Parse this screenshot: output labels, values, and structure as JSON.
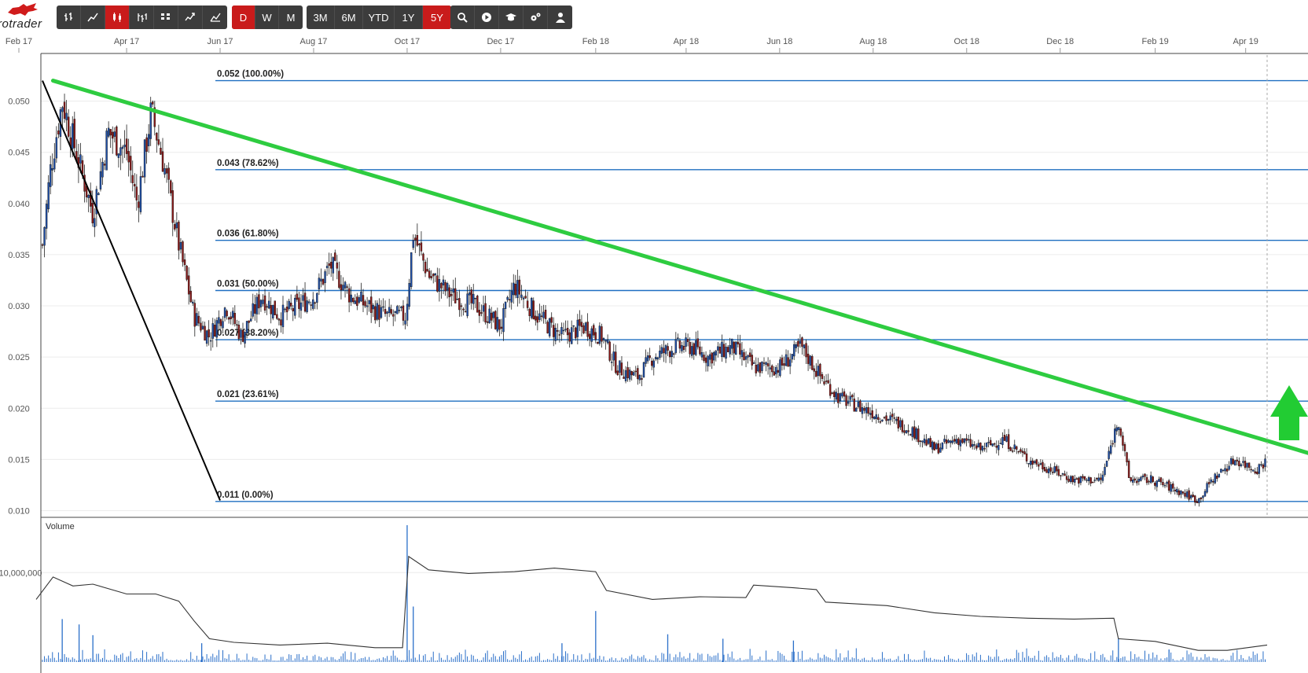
{
  "app": {
    "logo_text": "rotrader"
  },
  "toolbar": {
    "chart_types": [
      {
        "icon": "ohlc-bars-icon",
        "active": false
      },
      {
        "icon": "line-chart-icon",
        "active": false
      },
      {
        "icon": "candlestick-icon",
        "active": true
      },
      {
        "icon": "hlc-bars-icon",
        "active": false
      },
      {
        "icon": "renko-icon",
        "active": false
      },
      {
        "icon": "point-figure-icon",
        "active": false
      },
      {
        "icon": "mountain-chart-icon",
        "active": false
      }
    ],
    "intervals": [
      {
        "label": "D",
        "active": true
      },
      {
        "label": "W",
        "active": false
      },
      {
        "label": "M",
        "active": false
      }
    ],
    "ranges": [
      {
        "label": "3M",
        "active": false
      },
      {
        "label": "6M",
        "active": false
      },
      {
        "label": "YTD",
        "active": false
      },
      {
        "label": "1Y",
        "active": false
      },
      {
        "label": "5Y",
        "active": true
      }
    ],
    "tools": [
      {
        "icon": "search-icon"
      },
      {
        "icon": "play-icon"
      },
      {
        "icon": "graduation-cap-icon"
      },
      {
        "icon": "settings-gears-icon"
      },
      {
        "icon": "user-icon"
      }
    ]
  },
  "chart_data": {
    "type": "candlestick",
    "x_ticks": [
      "Feb 17",
      "Apr 17",
      "Jun 17",
      "Aug 17",
      "Oct 17",
      "Dec 17",
      "Feb 18",
      "Apr 18",
      "Jun 18",
      "Aug 18",
      "Oct 18",
      "Dec 18",
      "Feb 19",
      "Apr 19"
    ],
    "y_ticks": [
      "0.010",
      "0.015",
      "0.020",
      "0.025",
      "0.030",
      "0.035",
      "0.040",
      "0.045",
      "0.050"
    ],
    "ylim": [
      0.0095,
      0.0545
    ],
    "close_path": [
      [
        "2017-02-01",
        0.03
      ],
      [
        "2017-02-10",
        0.043
      ],
      [
        "2017-02-18",
        0.05
      ],
      [
        "2017-03-01",
        0.044
      ],
      [
        "2017-03-10",
        0.039
      ],
      [
        "2017-03-20",
        0.047
      ],
      [
        "2017-04-01",
        0.045
      ],
      [
        "2017-04-08",
        0.04
      ],
      [
        "2017-04-17",
        0.049
      ],
      [
        "2017-04-25",
        0.044
      ],
      [
        "2017-05-05",
        0.036
      ],
      [
        "2017-05-15",
        0.029
      ],
      [
        "2017-05-25",
        0.027
      ],
      [
        "2017-06-05",
        0.03
      ],
      [
        "2017-06-15",
        0.027
      ],
      [
        "2017-06-28",
        0.031
      ],
      [
        "2017-07-10",
        0.029
      ],
      [
        "2017-07-22",
        0.03
      ],
      [
        "2017-08-01",
        0.031
      ],
      [
        "2017-08-12",
        0.034
      ],
      [
        "2017-08-25",
        0.031
      ],
      [
        "2017-09-05",
        0.03
      ],
      [
        "2017-09-18",
        0.029
      ],
      [
        "2017-09-30",
        0.029
      ],
      [
        "2017-10-05",
        0.037
      ],
      [
        "2017-10-15",
        0.033
      ],
      [
        "2017-10-30",
        0.031
      ],
      [
        "2017-11-15",
        0.03
      ],
      [
        "2017-12-01",
        0.028
      ],
      [
        "2017-12-10",
        0.032
      ],
      [
        "2017-12-25",
        0.029
      ],
      [
        "2018-01-10",
        0.027
      ],
      [
        "2018-01-25",
        0.028
      ],
      [
        "2018-02-05",
        0.027
      ],
      [
        "2018-02-15",
        0.024
      ],
      [
        "2018-02-28",
        0.023
      ],
      [
        "2018-03-10",
        0.025
      ],
      [
        "2018-03-25",
        0.026
      ],
      [
        "2018-04-05",
        0.026
      ],
      [
        "2018-04-15",
        0.025
      ],
      [
        "2018-05-01",
        0.026
      ],
      [
        "2018-05-15",
        0.024
      ],
      [
        "2018-06-01",
        0.024
      ],
      [
        "2018-06-15",
        0.026
      ],
      [
        "2018-06-28",
        0.023
      ],
      [
        "2018-07-10",
        0.021
      ],
      [
        "2018-07-25",
        0.02
      ],
      [
        "2018-08-10",
        0.019
      ],
      [
        "2018-08-25",
        0.018
      ],
      [
        "2018-09-10",
        0.016
      ],
      [
        "2018-09-25",
        0.017
      ],
      [
        "2018-10-10",
        0.016
      ],
      [
        "2018-10-25",
        0.017
      ],
      [
        "2018-11-10",
        0.015
      ],
      [
        "2018-11-25",
        0.014
      ],
      [
        "2018-12-10",
        0.013
      ],
      [
        "2018-12-28",
        0.013
      ],
      [
        "2019-01-08",
        0.019
      ],
      [
        "2019-01-15",
        0.013
      ],
      [
        "2019-01-30",
        0.013
      ],
      [
        "2019-02-15",
        0.012
      ],
      [
        "2019-03-01",
        0.011
      ],
      [
        "2019-03-10",
        0.013
      ],
      [
        "2019-03-25",
        0.015
      ],
      [
        "2019-04-08",
        0.014
      ],
      [
        "2019-04-15",
        0.015
      ]
    ],
    "trendline_green": {
      "start": [
        "2017-02-12",
        0.052
      ],
      "end": [
        "2019-05-10",
        0.0148
      ],
      "color": "#2ecc40"
    },
    "fib_anchor_line": {
      "start": [
        "2017-02-01",
        0.052
      ],
      "end": [
        "2017-06-01",
        0.011
      ],
      "color": "#000000"
    },
    "fibonacci_levels": [
      {
        "label": "0.052 (100.00%)",
        "value": 0.052
      },
      {
        "label": "0.043 (78.62%)",
        "value": 0.0433
      },
      {
        "label": "0.036 (61.80%)",
        "value": 0.0364
      },
      {
        "label": "0.031 (50.00%)",
        "value": 0.0315
      },
      {
        "label": "0.027 (38.20%)",
        "value": 0.0267
      },
      {
        "label": "0.021 (23.61%)",
        "value": 0.0207
      },
      {
        "label": "0.011 (0.00%)",
        "value": 0.0109
      }
    ],
    "fib_color": "#1f6fc1",
    "up_color": "#1f4fa8",
    "down_color": "#8b1a1a",
    "arrow_color": "#22cc33",
    "volume": {
      "label": "Volume",
      "y_tick": "10,000,000",
      "ylim": [
        0,
        16000000
      ],
      "avg_path": [
        [
          "2017-02-01",
          7000000
        ],
        [
          "2017-02-12",
          9500000
        ],
        [
          "2017-02-25",
          8500000
        ],
        [
          "2017-03-10",
          8700000
        ],
        [
          "2017-04-01",
          7600000
        ],
        [
          "2017-04-20",
          7600000
        ],
        [
          "2017-05-05",
          6800000
        ],
        [
          "2017-05-15",
          4600000
        ],
        [
          "2017-05-25",
          2600000
        ],
        [
          "2017-06-10",
          2200000
        ],
        [
          "2017-07-10",
          1900000
        ],
        [
          "2017-08-10",
          2100000
        ],
        [
          "2017-09-10",
          1600000
        ],
        [
          "2017-09-28",
          1600000
        ],
        [
          "2017-10-02",
          11800000
        ],
        [
          "2017-10-15",
          10300000
        ],
        [
          "2017-11-10",
          9900000
        ],
        [
          "2017-12-10",
          10100000
        ],
        [
          "2018-01-05",
          10500000
        ],
        [
          "2018-02-01",
          10100000
        ],
        [
          "2018-02-08",
          8000000
        ],
        [
          "2018-03-10",
          7000000
        ],
        [
          "2018-04-10",
          7300000
        ],
        [
          "2018-05-10",
          7200000
        ],
        [
          "2018-05-15",
          8600000
        ],
        [
          "2018-06-10",
          8300000
        ],
        [
          "2018-06-25",
          8100000
        ],
        [
          "2018-07-01",
          6700000
        ],
        [
          "2018-08-10",
          6300000
        ],
        [
          "2018-09-10",
          5500000
        ],
        [
          "2018-10-10",
          5100000
        ],
        [
          "2018-11-10",
          4900000
        ],
        [
          "2018-12-10",
          4800000
        ],
        [
          "2019-01-05",
          4900000
        ],
        [
          "2019-01-08",
          2600000
        ],
        [
          "2019-02-01",
          2300000
        ],
        [
          "2019-03-01",
          1300000
        ],
        [
          "2019-03-20",
          1300000
        ],
        [
          "2019-04-15",
          1900000
        ]
      ],
      "spikes": [
        [
          "2017-02-18",
          4800000
        ],
        [
          "2017-03-01",
          4200000
        ],
        [
          "2017-03-10",
          3000000
        ],
        [
          "2017-05-20",
          2100000
        ],
        [
          "2017-10-01",
          15300000
        ],
        [
          "2017-10-05",
          6200000
        ],
        [
          "2018-01-10",
          2100000
        ],
        [
          "2018-02-01",
          5700000
        ],
        [
          "2018-03-20",
          3100000
        ],
        [
          "2018-04-25",
          2600000
        ],
        [
          "2018-06-10",
          2400000
        ],
        [
          "2019-01-08",
          2600000
        ],
        [
          "2019-02-10",
          1400000
        ]
      ]
    }
  }
}
